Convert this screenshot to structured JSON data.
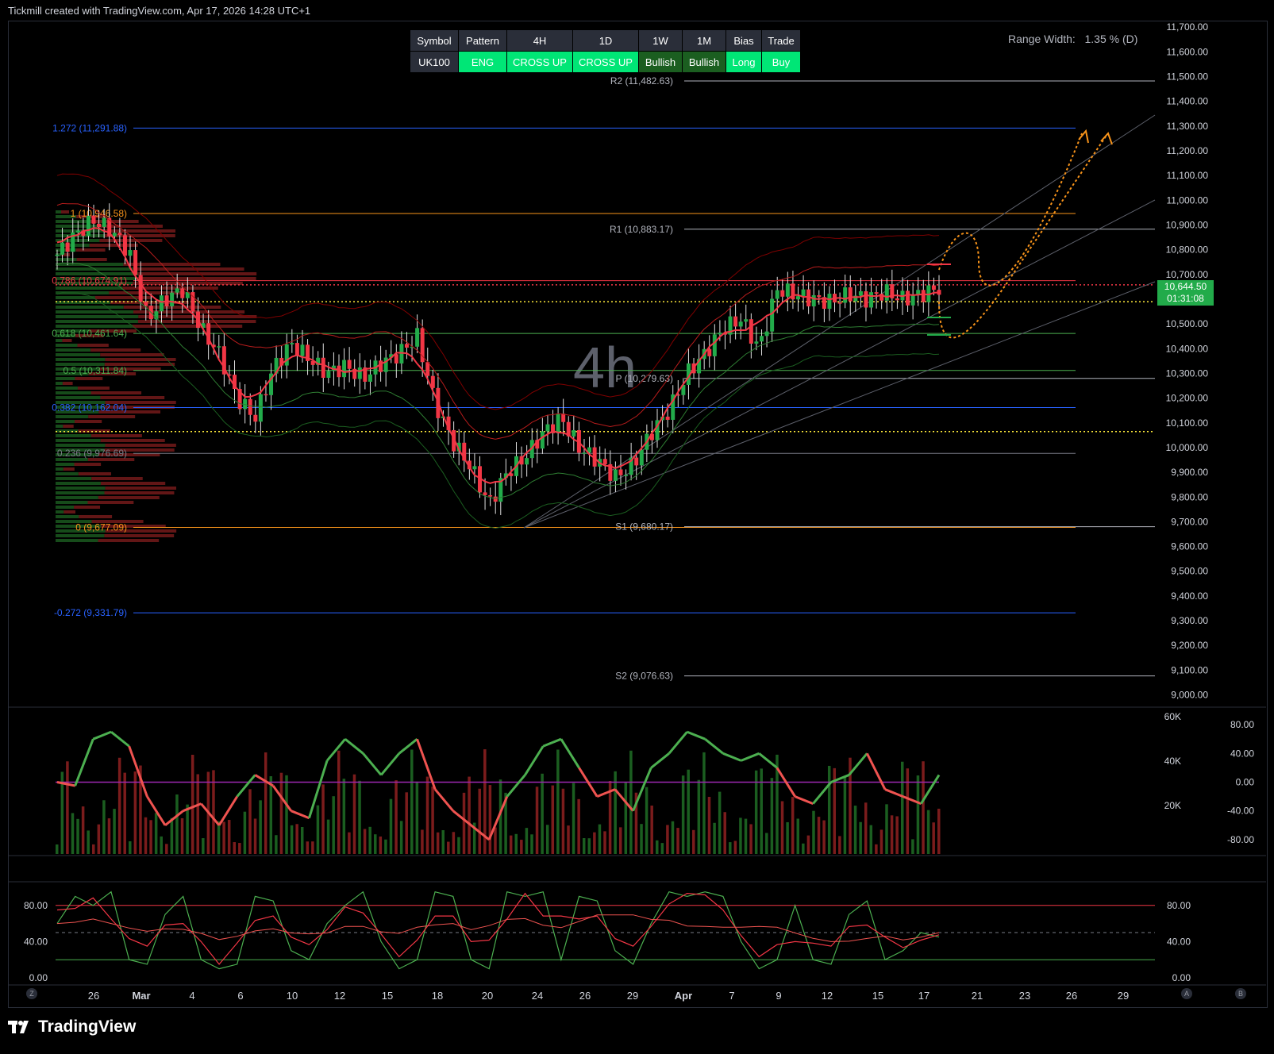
{
  "header": {
    "text": "Tickmill created with TradingView.com, Apr 17, 2026 14:28 UTC+1"
  },
  "footer": {
    "brand": "TradingView"
  },
  "signal_table": {
    "headers": [
      "Symbol",
      "Pattern",
      "4H",
      "1D",
      "1W",
      "1M",
      "Bias",
      "Trade"
    ],
    "values": [
      "UK100",
      "ENG",
      "CROSS UP",
      "CROSS UP",
      "Bullish",
      "Bullish",
      "Long",
      "Buy"
    ],
    "value_colors": [
      "#2a2e39",
      "#00e676",
      "#00e676",
      "#00e676",
      "#1b5e20",
      "#1b5e20",
      "#00e676",
      "#00e676"
    ]
  },
  "range_width": {
    "label": "Range Width:",
    "value": "1.35 % (D)"
  },
  "interval_watermark": "4h",
  "price_tag": {
    "price": "10,644.50",
    "countdown": "01:31:08"
  },
  "colors": {
    "bull": "#22ab4a",
    "bear": "#f23645",
    "orange": "#f7931a",
    "blue": "#2962ff",
    "purple": "#9c27b0"
  },
  "chart_data": [
    {
      "type": "candlestick",
      "symbol": "UK100",
      "interval": "4h",
      "y_axis_ticks": [
        "11,700.00",
        "11,600.00",
        "11,500.00",
        "11,400.00",
        "11,300.00",
        "11,200.00",
        "11,100.00",
        "11,000.00",
        "10,900.00",
        "10,800.00",
        "10,700.00",
        "10,600.00",
        "10,500.00",
        "10,400.00",
        "10,300.00",
        "10,200.00",
        "10,100.00",
        "10,000.00",
        "9,900.00",
        "9,800.00",
        "9,700.00",
        "9,600.00",
        "9,500.00",
        "9,400.00",
        "9,300.00",
        "9,200.00",
        "9,100.00",
        "9,000.00"
      ],
      "ylim": [
        8960,
        11720
      ],
      "x_axis_ticks": [
        "26",
        "Mar",
        "4",
        "6",
        "10",
        "12",
        "15",
        "18",
        "20",
        "24",
        "26",
        "29",
        "Apr",
        "7",
        "9",
        "12",
        "15",
        "17",
        "21",
        "23",
        "26",
        "29"
      ],
      "price_path": [
        10780,
        10860,
        10920,
        10880,
        10790,
        10520,
        10600,
        10640,
        10480,
        10380,
        10200,
        10120,
        10320,
        10420,
        10360,
        10300,
        10330,
        10280,
        10340,
        10380,
        10450,
        10180,
        10020,
        9920,
        9770,
        9900,
        9960,
        10060,
        10120,
        10000,
        9950,
        9880,
        9930,
        10060,
        10150,
        10300,
        10380,
        10480,
        10520,
        10400,
        10640,
        10620,
        10600,
        10590,
        10620,
        10600,
        10630,
        10600,
        10620,
        10644.5
      ],
      "levels": [
        {
          "label": "R2 (11,482.63)",
          "value": 11482.63,
          "color": "#b2b5be"
        },
        {
          "label": "R1 (10,883.17)",
          "value": 10883.17,
          "color": "#b2b5be"
        },
        {
          "label": "P (10,279.63)",
          "value": 10279.63,
          "color": "#b2b5be"
        },
        {
          "label": "S1 (9,680.17)",
          "value": 9680.17,
          "color": "#b2b5be"
        },
        {
          "label": "S2 (9,076.63)",
          "value": 9076.63,
          "color": "#b2b5be"
        }
      ],
      "fib_levels": [
        {
          "label": "1.272 (11,291.88)",
          "value": 11291.88,
          "color": "#2962ff"
        },
        {
          "label": "1 (10,946.58)",
          "value": 10946.58,
          "color": "#f7931a"
        },
        {
          "label": "0.786 (10,674.91)",
          "value": 10674.91,
          "color": "#f23645"
        },
        {
          "label": "0.618 (10,461.64)",
          "value": 10461.64,
          "color": "#4caf50"
        },
        {
          "label": "0.5 (10,311.84)",
          "value": 10311.84,
          "color": "#4caf50"
        },
        {
          "label": "0.382 (10,162.04)",
          "value": 10162.04,
          "color": "#2962ff"
        },
        {
          "label": "0.236 (9,976.69)",
          "value": 9976.69,
          "color": "#787b86"
        },
        {
          "label": "0 (9,677.09)",
          "value": 9677.09,
          "color": "#f7931a"
        },
        {
          "label": "-0.272 (9,331.79)",
          "value": 9331.79,
          "color": "#2962ff"
        }
      ],
      "dotted_levels": [
        {
          "value": 10658,
          "color": "#f23645"
        },
        {
          "value": 10590,
          "color": "#ffeb3b"
        },
        {
          "value": 10065,
          "color": "#ffeb3b"
        }
      ],
      "projection_targets": [
        11260,
        10400
      ]
    },
    {
      "type": "bar",
      "name": "volume_oscillator",
      "left_ticks": [
        "60K",
        "40K",
        "20K"
      ],
      "right_ticks": [
        "80.00",
        "40.00",
        "0.00",
        "-40.00",
        "-80.00"
      ],
      "ylim": [
        -100,
        100
      ],
      "osc_values": [
        0,
        -5,
        60,
        70,
        50,
        -20,
        -60,
        -40,
        -30,
        -60,
        -20,
        10,
        -5,
        -40,
        -50,
        30,
        60,
        40,
        10,
        40,
        60,
        -10,
        -40,
        -60,
        -80,
        -20,
        10,
        50,
        60,
        20,
        -20,
        -10,
        -40,
        20,
        40,
        70,
        60,
        40,
        30,
        40,
        20,
        -20,
        -30,
        0,
        10,
        40,
        -10,
        -20,
        -30,
        10
      ]
    },
    {
      "type": "line",
      "name": "stochastic",
      "left_ticks": [
        "80.00",
        "40.00",
        "0.00"
      ],
      "right_ticks": [
        "80.00",
        "40.00",
        "0.00"
      ],
      "ylim": [
        0,
        100
      ],
      "k_values": [
        60,
        90,
        80,
        95,
        20,
        15,
        70,
        90,
        20,
        10,
        15,
        90,
        85,
        30,
        20,
        60,
        80,
        95,
        40,
        10,
        20,
        95,
        90,
        20,
        10,
        95,
        90,
        95,
        20,
        90,
        85,
        30,
        15,
        60,
        95,
        90,
        95,
        90,
        40,
        10,
        20,
        80,
        20,
        15,
        70,
        85,
        20,
        30,
        50,
        45
      ]
    }
  ]
}
